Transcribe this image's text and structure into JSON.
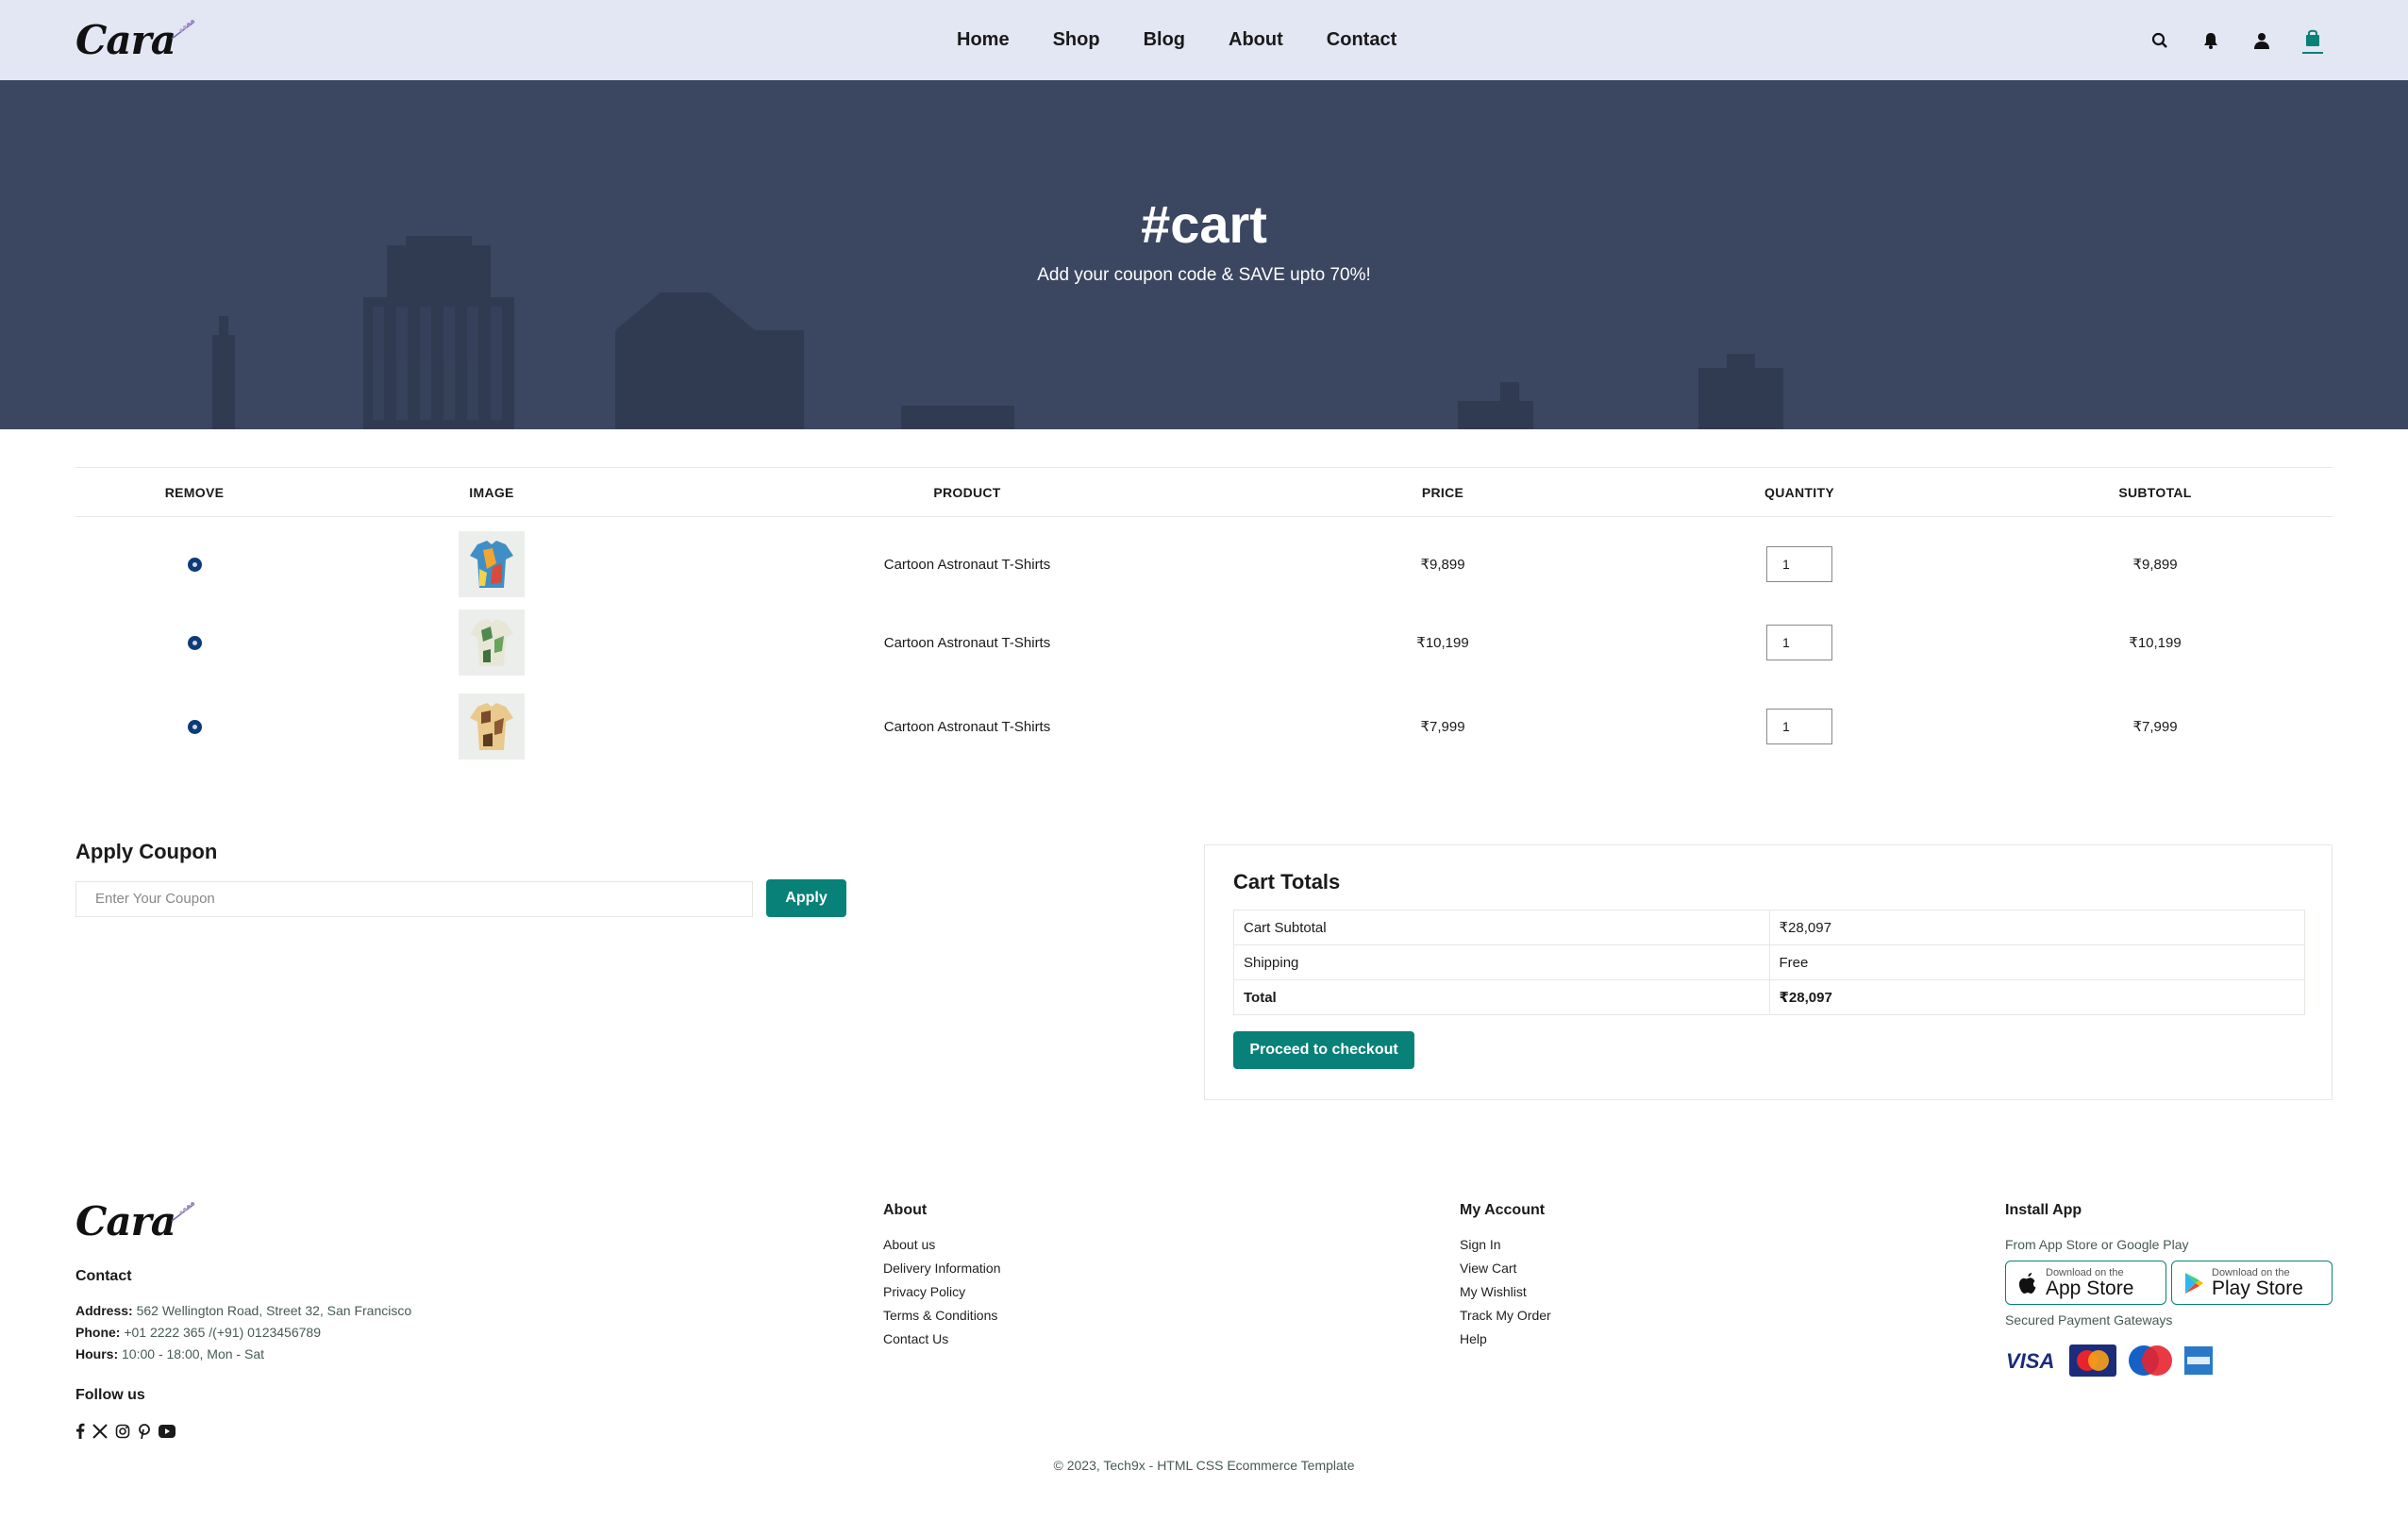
{
  "brand": {
    "name": "Cara"
  },
  "nav": {
    "items": [
      "Home",
      "Shop",
      "Blog",
      "About",
      "Contact"
    ],
    "icons": [
      "search-icon",
      "bell-icon",
      "user-icon",
      "shopping-bag-icon"
    ]
  },
  "hero": {
    "title": "#cart",
    "subtitle": "Add your coupon code & SAVE upto 70%!"
  },
  "cart": {
    "headers": [
      "REMOVE",
      "IMAGE",
      "PRODUCT",
      "PRICE",
      "QUANTITY",
      "SUBTOTAL"
    ],
    "rows": [
      {
        "product": "Cartoon Astronaut T-Shirts",
        "price": "₹9,899",
        "quantity": "1",
        "subtotal": "₹9,899"
      },
      {
        "product": "Cartoon Astronaut T-Shirts",
        "price": "₹10,199",
        "quantity": "1",
        "subtotal": "₹10,199"
      },
      {
        "product": "Cartoon Astronaut T-Shirts",
        "price": "₹7,999",
        "quantity": "1",
        "subtotal": "₹7,999"
      }
    ]
  },
  "coupon": {
    "title": "Apply Coupon",
    "placeholder": "Enter Your Coupon",
    "button": "Apply"
  },
  "totals": {
    "title": "Cart Totals",
    "rows": [
      {
        "label": "Cart Subtotal",
        "value": "₹28,097"
      },
      {
        "label": "Shipping",
        "value": "Free"
      },
      {
        "label": "Total",
        "value": "₹28,097"
      }
    ],
    "checkout": "Proceed to checkout"
  },
  "footer": {
    "contact_heading": "Contact",
    "address_label": "Address:",
    "address": "562 Wellington Road, Street 32, San Francisco",
    "phone_label": "Phone:",
    "phone": "+01 2222 365 /(+91) 0123456789",
    "hours_label": "Hours:",
    "hours": "10:00 - 18:00, Mon - Sat",
    "follow_heading": "Follow us",
    "social_icons": [
      "facebook-icon",
      "x-icon",
      "instagram-icon",
      "pinterest-icon",
      "youtube-icon"
    ],
    "about_heading": "About",
    "about_links": [
      "About us",
      "Delivery Information",
      "Privacy Policy",
      "Terms & Conditions",
      "Contact Us"
    ],
    "account_heading": "My Account",
    "account_links": [
      "Sign In",
      "View Cart",
      "My Wishlist",
      "Track My Order",
      "Help"
    ],
    "install_heading": "Install App",
    "install_sub": "From App Store or Google Play",
    "app_store": {
      "small": "Download on the",
      "big": "App Store"
    },
    "play_store": {
      "small": "Download on the",
      "big": "Play Store"
    },
    "payment_heading": "Secured Payment Gateways",
    "payment_icons": [
      "visa-icon",
      "mastercard-icon",
      "maestro-icon",
      "amex-icon"
    ],
    "copyright": "© 2023, Tech9x - HTML CSS Ecommerce Template"
  },
  "colors": {
    "accent": "#088178",
    "header_bg": "#e3e6f3",
    "hero_bg": "#3b4660",
    "remove": "#0d3b7a"
  }
}
